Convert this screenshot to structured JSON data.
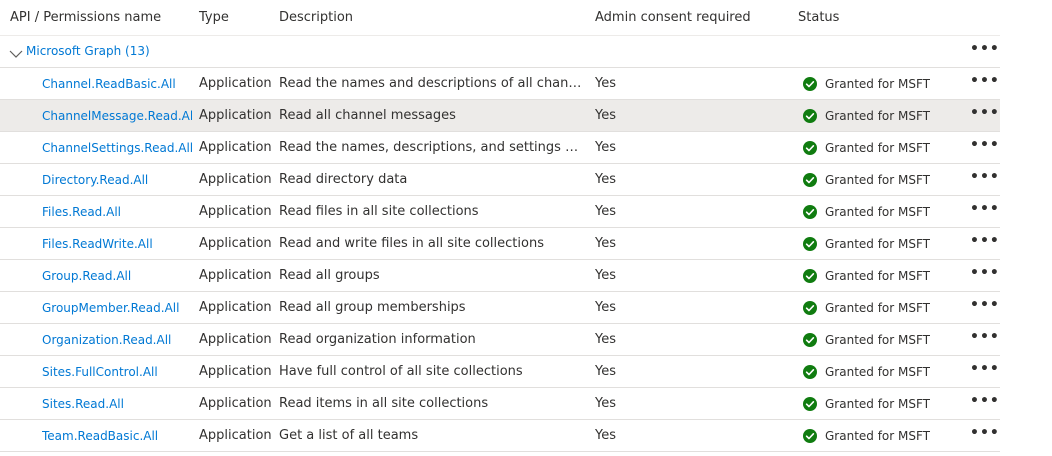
{
  "columns": {
    "name": "API / Permissions name",
    "type": "Type",
    "description": "Description",
    "admin_consent": "Admin consent required",
    "status": "Status"
  },
  "group": {
    "label": "Microsoft Graph (13)",
    "toggle_icon": "chevron-down-icon",
    "more_icon": "more-icon"
  },
  "colors": {
    "link": "#0078d4",
    "granted": "#107c10",
    "hover_row": "#edebe9",
    "divider": "#e1dfdd"
  },
  "more_glyph": "•••",
  "rows": [
    {
      "name": "Channel.ReadBasic.All",
      "type": "Application",
      "description": "Read the names and descriptions of all channels",
      "admin": "Yes",
      "status": "Granted for MSFT",
      "status_icon": "check-circle-icon"
    },
    {
      "name": "ChannelMessage.Read.All",
      "type": "Application",
      "description": "Read all channel messages",
      "admin": "Yes",
      "status": "Granted for MSFT",
      "status_icon": "check-circle-icon",
      "hovered": true
    },
    {
      "name": "ChannelSettings.Read.All",
      "type": "Application",
      "description": "Read the names, descriptions, and settings of all ch...",
      "admin": "Yes",
      "status": "Granted for MSFT",
      "status_icon": "check-circle-icon"
    },
    {
      "name": "Directory.Read.All",
      "type": "Application",
      "description": "Read directory data",
      "admin": "Yes",
      "status": "Granted for MSFT",
      "status_icon": "check-circle-icon"
    },
    {
      "name": "Files.Read.All",
      "type": "Application",
      "description": "Read files in all site collections",
      "admin": "Yes",
      "status": "Granted for MSFT",
      "status_icon": "check-circle-icon"
    },
    {
      "name": "Files.ReadWrite.All",
      "type": "Application",
      "description": "Read and write files in all site collections",
      "admin": "Yes",
      "status": "Granted for MSFT",
      "status_icon": "check-circle-icon"
    },
    {
      "name": "Group.Read.All",
      "type": "Application",
      "description": "Read all groups",
      "admin": "Yes",
      "status": "Granted for MSFT",
      "status_icon": "check-circle-icon"
    },
    {
      "name": "GroupMember.Read.All",
      "type": "Application",
      "description": "Read all group memberships",
      "admin": "Yes",
      "status": "Granted for MSFT",
      "status_icon": "check-circle-icon"
    },
    {
      "name": "Organization.Read.All",
      "type": "Application",
      "description": "Read organization information",
      "admin": "Yes",
      "status": "Granted for MSFT",
      "status_icon": "check-circle-icon"
    },
    {
      "name": "Sites.FullControl.All",
      "type": "Application",
      "description": "Have full control of all site collections",
      "admin": "Yes",
      "status": "Granted for MSFT",
      "status_icon": "check-circle-icon"
    },
    {
      "name": "Sites.Read.All",
      "type": "Application",
      "description": "Read items in all site collections",
      "admin": "Yes",
      "status": "Granted for MSFT",
      "status_icon": "check-circle-icon"
    },
    {
      "name": "Team.ReadBasic.All",
      "type": "Application",
      "description": "Get a list of all teams",
      "admin": "Yes",
      "status": "Granted for MSFT",
      "status_icon": "check-circle-icon"
    }
  ]
}
